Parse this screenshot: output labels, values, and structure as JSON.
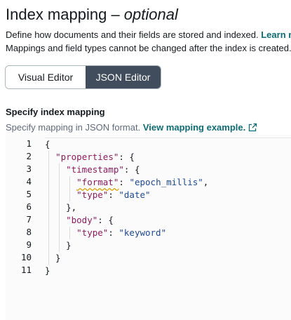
{
  "header": {
    "title_main": "Index mapping",
    "title_dash": " – ",
    "title_optional": "optional"
  },
  "description": {
    "line1_text": "Define how documents and their fields are stored and indexed. ",
    "line1_link": "Learn more",
    "line2_text": "Mappings and field types cannot be changed after the index is created."
  },
  "editor_tabs": {
    "visual_label": "Visual Editor",
    "json_label": "JSON Editor",
    "selected": "JSON Editor"
  },
  "section": {
    "label": "Specify index mapping",
    "hint_text": "Specify mapping in JSON format. ",
    "hint_link": "View mapping example.",
    "hint_icon": "external-link-icon"
  },
  "code_editor": {
    "line_numbers": [
      "1",
      "2",
      "3",
      "4",
      "5",
      "6",
      "7",
      "8",
      "9",
      "10",
      "11"
    ],
    "lines": [
      [
        {
          "t": "{",
          "c": "plain"
        }
      ],
      [
        {
          "t": "  ",
          "c": "plain"
        },
        {
          "t": "\"properties\"",
          "c": "key"
        },
        {
          "t": ": {",
          "c": "plain"
        }
      ],
      [
        {
          "t": "    ",
          "c": "plain"
        },
        {
          "t": "\"timestamp\"",
          "c": "key"
        },
        {
          "t": ": {",
          "c": "plain"
        }
      ],
      [
        {
          "t": "      ",
          "c": "plain"
        },
        {
          "t": "\"format\"",
          "c": "key",
          "squig": true
        },
        {
          "t": ": ",
          "c": "plain"
        },
        {
          "t": "\"epoch_millis\"",
          "c": "str"
        },
        {
          "t": ",",
          "c": "plain"
        }
      ],
      [
        {
          "t": "      ",
          "c": "plain"
        },
        {
          "t": "\"type\"",
          "c": "key"
        },
        {
          "t": ": ",
          "c": "plain"
        },
        {
          "t": "\"date\"",
          "c": "str"
        }
      ],
      [
        {
          "t": "    },",
          "c": "plain"
        }
      ],
      [
        {
          "t": "    ",
          "c": "plain"
        },
        {
          "t": "\"body\"",
          "c": "key"
        },
        {
          "t": ": {",
          "c": "plain"
        }
      ],
      [
        {
          "t": "      ",
          "c": "plain"
        },
        {
          "t": "\"type\"",
          "c": "key"
        },
        {
          "t": ": ",
          "c": "plain"
        },
        {
          "t": "\"keyword\"",
          "c": "str"
        }
      ],
      [
        {
          "t": "    }",
          "c": "plain"
        }
      ],
      [
        {
          "t": "  }",
          "c": "plain"
        }
      ],
      [
        {
          "t": "}",
          "c": "plain"
        }
      ]
    ],
    "colors": {
      "key": "#8a1b5f",
      "string": "#1d4a8f"
    }
  },
  "colors": {
    "link": "#0f6b73",
    "selected_tab_bg": "#414d5c",
    "text": "#16191f",
    "hint": "#5f6b7a"
  }
}
